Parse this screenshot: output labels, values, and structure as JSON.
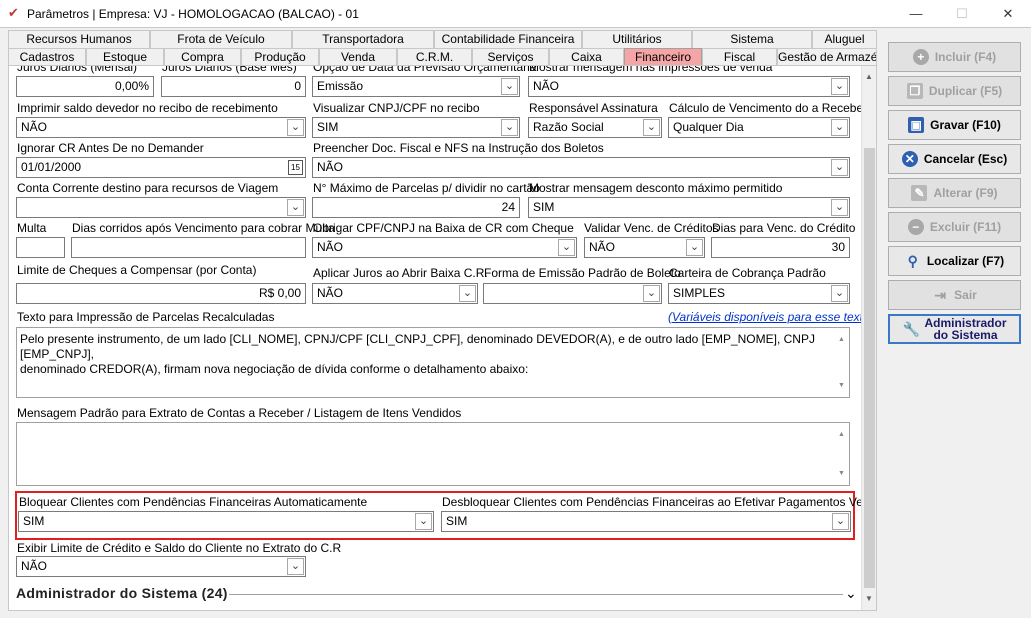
{
  "window": {
    "title": "Parâmetros | Empresa: VJ - HOMOLOGACAO (BALCAO) - 01",
    "minimize": "—",
    "maximize": "☐",
    "close": "✕"
  },
  "tabs_row1": [
    "Recursos Humanos",
    "Frota de Veículo",
    "Transportadora",
    "Contabilidade Financeira",
    "Utilitários",
    "Sistema",
    "Aluguel"
  ],
  "tabs_row2": [
    "Cadastros",
    "Estoque",
    "Compra",
    "Produção",
    "Venda",
    "C.R.M.",
    "Serviços",
    "Caixa",
    "Financeiro",
    "Fiscal",
    "Gestão de Armazém"
  ],
  "active_tab": "Financeiro",
  "top_partial": {
    "f1_label": "Juros Diários (Mensal)",
    "f1_value": "0,00%",
    "f2_label": "Juros Diários (Base Mês)",
    "f2_value": "0",
    "f3_label": "Opção de Data da Previsão Orçamentária",
    "f3_value": "Emissão",
    "f4_label": "Mostrar mensagem nas impressões de venda",
    "f4_value": "NÃO"
  },
  "row2": {
    "a_label": "Imprimir saldo devedor no recibo de recebimento",
    "a_value": "NÃO",
    "b_label": "Visualizar CNPJ/CPF no recibo",
    "b_value": "SIM",
    "c_label": "Responsável Assinatura",
    "c_value": "Razão Social",
    "d_label": "Cálculo de Vencimento do a Receber",
    "d_value": "Qualquer Dia"
  },
  "row3": {
    "a_label": "Ignorar CR Antes De no Demander",
    "a_value": "01/01/2000",
    "cal": "15",
    "b_label": "Preencher Doc. Fiscal e NFS na Instrução dos Boletos",
    "b_value": "NÃO"
  },
  "row4": {
    "a_label": "Conta Corrente destino para recursos de Viagem",
    "a_value": "",
    "b_label": "N° Máximo de Parcelas p/ dividir no cartão",
    "b_value": "24",
    "c_label": "Mostrar mensagem desconto máximo permitido",
    "c_value": "SIM"
  },
  "row5": {
    "a_label": "Multa",
    "a_value": "",
    "b_label": "Dias corridos após Vencimento para cobrar Multa",
    "b_value": "",
    "c_label": "Obrigar CPF/CNPJ na Baixa de CR com Cheque",
    "c_value": "NÃO",
    "d_label": "Validar Venc. de Créditos",
    "d_value": "NÃO",
    "e_label": "Dias para Venc. do Crédito",
    "e_value": "30"
  },
  "row6": {
    "a_label": "Limite de Cheques a Compensar (por Conta)",
    "a_value": "R$ 0,00",
    "b_label": "Aplicar Juros ao Abrir Baixa C.R.",
    "b_value": "NÃO",
    "c_label": "Forma de Emissão Padrão de Boleto",
    "c_value": "",
    "d_label": "Carteira de Cobrança Padrão",
    "d_value": "SIMPLES"
  },
  "texto": {
    "label": "Texto para Impressão de Parcelas Recalculadas",
    "link": "(Variáveis disponíveis para esse texto)",
    "line1": "Pelo presente instrumento, de um lado [CLI_NOME], CPNJ/CPF [CLI_CNPJ_CPF], denominado DEVEDOR(A), e de outro lado [EMP_NOME], CNPJ [EMP_CNPJ],",
    "line2": "denominado CREDOR(A), firmam nova negociação de dívida conforme o detalhamento abaixo:"
  },
  "mensagem": {
    "label": "Mensagem Padrão para Extrato de Contas a Receber / Listagem de Itens Vendidos",
    "value": ""
  },
  "bloqueio": {
    "a_label": "Bloquear Clientes com Pendências Financeiras Automaticamente",
    "a_value": "SIM",
    "b_label": "Desbloquear Clientes com Pendências Financeiras ao Efetivar Pagamentos Vencidos",
    "b_value": "SIM"
  },
  "limite": {
    "label": "Exibir Limite de Crédito e Saldo do Cliente no Extrato do C.R",
    "value": "NÃO"
  },
  "section": {
    "title": "Administrador do Sistema (24)"
  },
  "buttons": {
    "incluir": "Incluir (F4)",
    "duplicar": "Duplicar (F5)",
    "gravar": "Gravar (F10)",
    "cancelar": "Cancelar (Esc)",
    "alterar": "Alterar (F9)",
    "excluir": "Excluir (F11)",
    "localizar": "Localizar (F7)",
    "sair": "Sair",
    "admin_line1": "Administrador",
    "admin_line2": "do Sistema"
  },
  "colors": {
    "active_tab": "#f5a5a5",
    "highlight_box": "#e02020",
    "link": "#0033cc"
  }
}
